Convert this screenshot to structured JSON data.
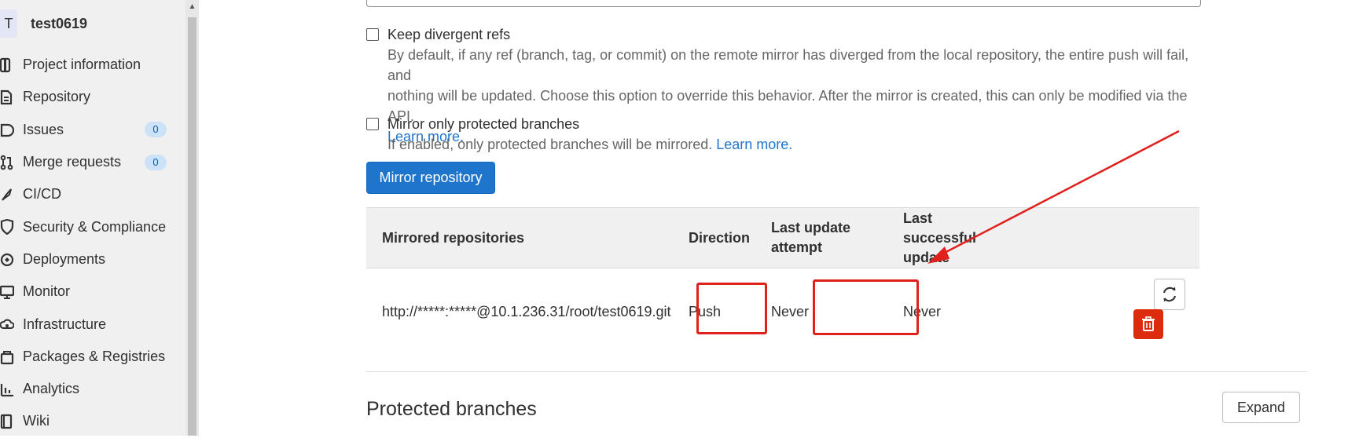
{
  "sidebar": {
    "avatar_letter": "T",
    "project_name": "test0619",
    "items": [
      {
        "label": "Project information",
        "icon": "project-info-icon"
      },
      {
        "label": "Repository",
        "icon": "document-icon"
      },
      {
        "label": "Issues",
        "icon": "issues-icon",
        "badge": "0"
      },
      {
        "label": "Merge requests",
        "icon": "merge-request-icon",
        "badge": "0"
      },
      {
        "label": "CI/CD",
        "icon": "rocket-icon"
      },
      {
        "label": "Security & Compliance",
        "icon": "shield-icon"
      },
      {
        "label": "Deployments",
        "icon": "deployments-icon"
      },
      {
        "label": "Monitor",
        "icon": "monitor-icon"
      },
      {
        "label": "Infrastructure",
        "icon": "cloud-icon"
      },
      {
        "label": "Packages & Registries",
        "icon": "package-icon"
      },
      {
        "label": "Analytics",
        "icon": "chart-icon"
      },
      {
        "label": "Wiki",
        "icon": "book-icon"
      }
    ]
  },
  "options": {
    "keep_divergent": {
      "title": "Keep divergent refs",
      "help_line1": "By default, if any ref (branch, tag, or commit) on the remote mirror has diverged from the local repository, the entire push will fail, and",
      "help_line2": "nothing will be updated. Choose this option to override this behavior. After the mirror is created, this can only be modified via the API.",
      "learn_more": "Learn more."
    },
    "protected_only": {
      "title": "Mirror only protected branches",
      "help": "If enabled, only protected branches will be mirrored.",
      "learn_more": "Learn more."
    }
  },
  "mirror_button": "Mirror repository",
  "table": {
    "headers": {
      "repo": "Mirrored repositories",
      "direction": "Direction",
      "last_attempt": "Last update attempt",
      "last_success": "Last successful update"
    },
    "rows": [
      {
        "url": "http://*****:*****@10.1.236.31/root/test0619.git",
        "direction": "Push",
        "last_attempt": "Never",
        "last_success": "Never"
      }
    ]
  },
  "protected_branches": {
    "title": "Protected branches",
    "expand": "Expand"
  },
  "colors": {
    "primary": "#1f75cb",
    "danger": "#dd2b0e",
    "annotation": "#e0201b"
  }
}
